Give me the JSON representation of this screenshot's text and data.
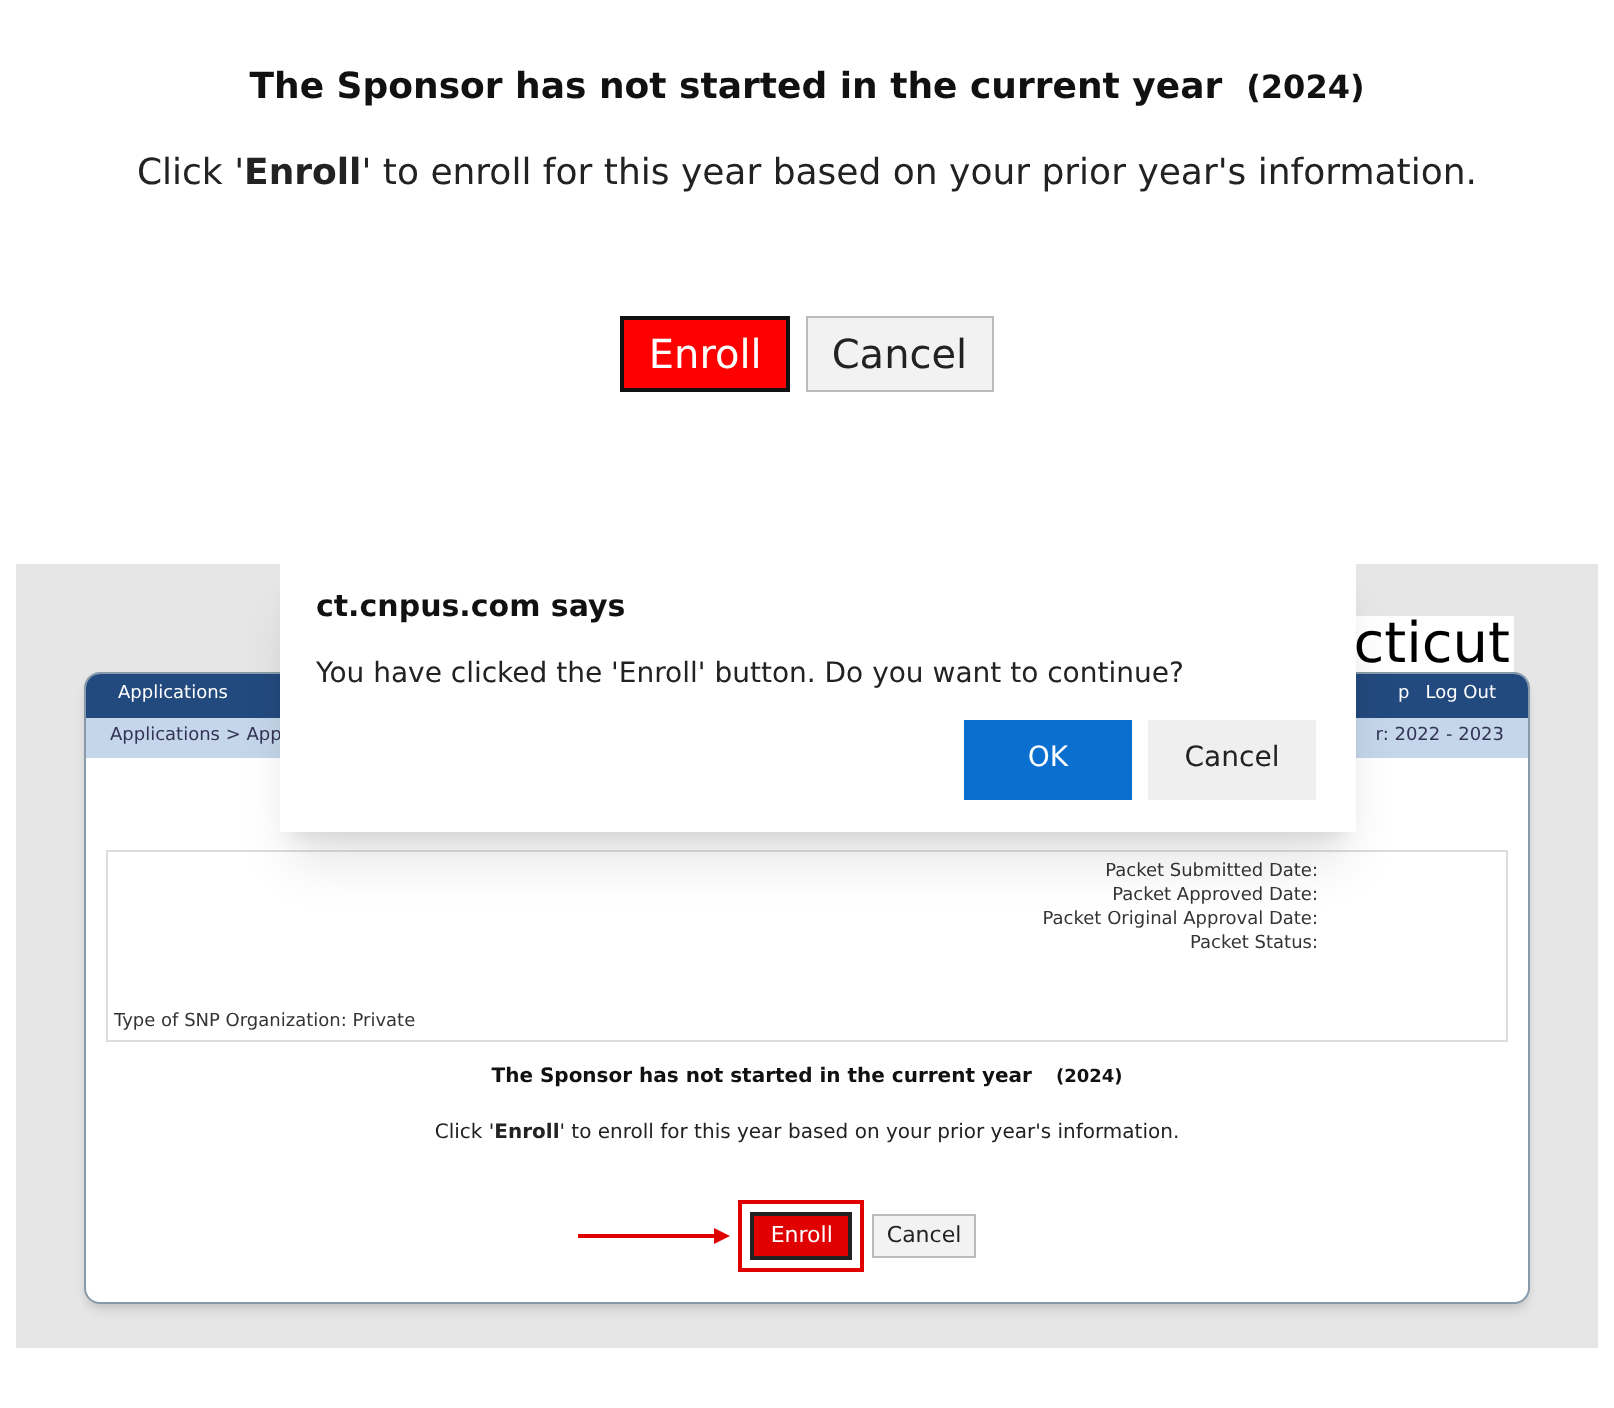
{
  "notice": {
    "heading": "The Sponsor has not started in the current year",
    "year": "(2024)",
    "instruction": "Click '**Enroll**' to enroll for this year based on your prior year's information.",
    "buttons": [
      {
        "kind": "primary",
        "label": "Enroll"
      },
      {
        "kind": "secondary",
        "label": "Cancel"
      }
    ]
  },
  "screenshot": {
    "site_title": "cticut",
    "nav": {
      "left": "Applications",
      "right_partial": "p",
      "right": "Log Out"
    },
    "breadcrumb": {
      "left": "Applications > App",
      "right": "r: 2022 - 2023"
    },
    "packet_fields": [
      "Packet Submitted Date:",
      "Packet Approved Date:",
      "Packet Original Approval Date:",
      "Packet Status:"
    ],
    "org_type": "Type of SNP Organization: Private",
    "notice": {
      "heading": "The Sponsor has not started in the current year",
      "year": "(2024)",
      "instruction": "Click '**Enroll**' to enroll for this year based on your prior year's information.",
      "buttons": [
        {
          "kind": "primary",
          "label": "Enroll",
          "highlighted": true
        },
        {
          "kind": "secondary",
          "label": "Cancel",
          "highlighted": false
        }
      ]
    },
    "dialog": {
      "title": "ct.cnpus.com says",
      "message": "You have clicked the 'Enroll' button. Do you want to continue?",
      "buttons": [
        {
          "kind": "primary",
          "label": "OK"
        },
        {
          "kind": "secondary",
          "label": "Cancel"
        }
      ]
    }
  }
}
